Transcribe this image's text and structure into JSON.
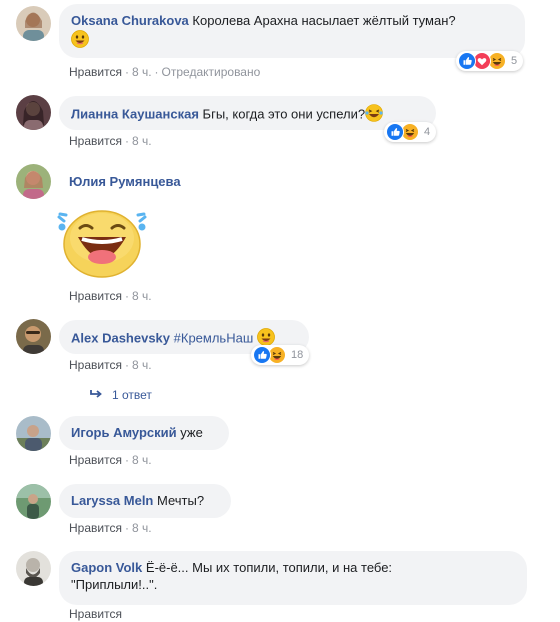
{
  "comments": [
    {
      "author": "Oksana Churakova",
      "text": "Королева Арахна насылает жёлтый туман?",
      "actions": {
        "like": "Нравится",
        "time": "8 ч.",
        "edited": "Отредактировано"
      },
      "reactions": {
        "icons": [
          "like-icon",
          "love-icon",
          "haha-icon"
        ],
        "count": "5"
      }
    },
    {
      "author": "Лианна Каушанская",
      "text": "Бгы, когда это они успели?",
      "actions": {
        "like": "Нравится",
        "time": "8 ч."
      },
      "reactions": {
        "icons": [
          "like-icon",
          "haha-icon"
        ],
        "count": "4"
      }
    },
    {
      "author": "Юлия Румянцева",
      "text": "",
      "actions": {
        "like": "Нравится",
        "time": "8 ч."
      }
    },
    {
      "author": "Alex Dashevsky",
      "text": "#КремльНаш",
      "actions": {
        "like": "Нравится",
        "time": "8 ч."
      },
      "reactions": {
        "icons": [
          "like-icon",
          "haha-icon"
        ],
        "count": "18"
      },
      "replies_label": "1 ответ"
    },
    {
      "author": "Игорь Амурский",
      "text": "уже",
      "actions": {
        "like": "Нравится",
        "time": "8 ч."
      }
    },
    {
      "author": "Laryssa Meln",
      "text": "Мечты?",
      "actions": {
        "like": "Нравится",
        "time": "8 ч."
      }
    },
    {
      "author": "Gapon Volk",
      "text": "Ё-ё-ё... Мы их топили, топили, и на тебе:",
      "text_line2": "\"Приплыли!..\".",
      "actions": {
        "like": "Нравится"
      }
    }
  ],
  "colors": {
    "author": "#385898",
    "meta": "#90949c",
    "bubble": "#f2f3f5",
    "like": "#1877f2",
    "love": "#f33e58",
    "haha": "#f7b125"
  }
}
